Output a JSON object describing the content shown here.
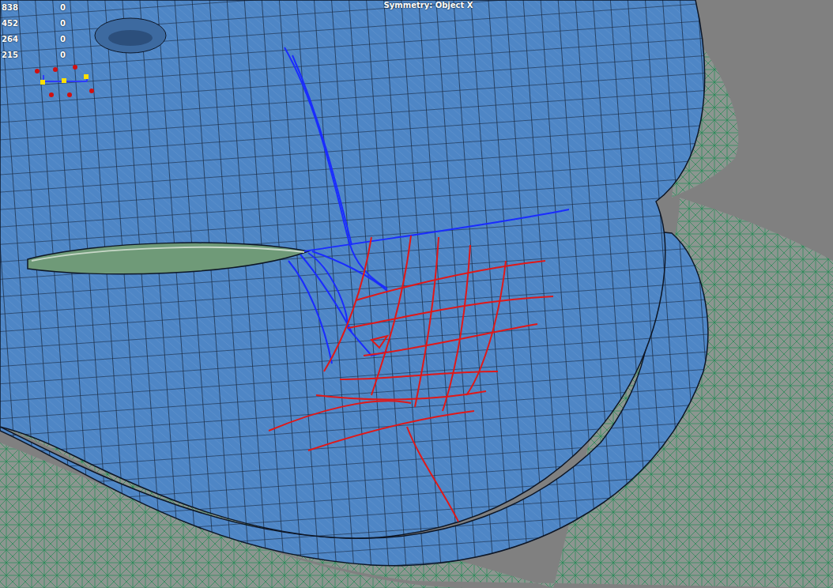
{
  "viewport": {
    "symmetry": "Symmetry: Object X"
  },
  "stats": [
    {
      "value": "838",
      "count": "0"
    },
    {
      "value": "452",
      "count": "0"
    },
    {
      "value": "264",
      "count": "0"
    },
    {
      "value": "215",
      "count": "0"
    }
  ]
}
